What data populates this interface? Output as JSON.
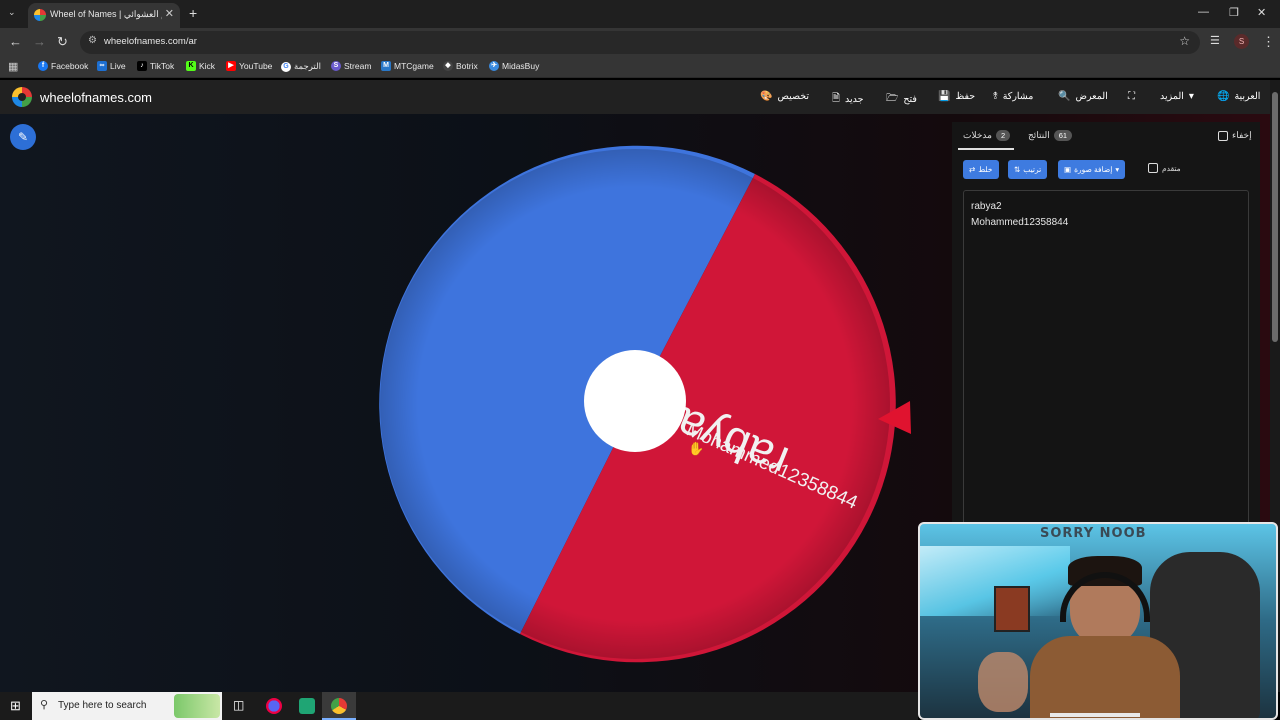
{
  "browser": {
    "tab_title": "Wheel of Names | عجلة الاسم العشوائي",
    "url": "wheelofnames.com/ar",
    "bookmarks": [
      "Facebook",
      "Live",
      "TikTok",
      "Kick",
      "YouTube",
      "الترجمة",
      "Stream",
      "MTCgame",
      "Botrix",
      "MidasBuy"
    ],
    "profile_initial": "S"
  },
  "site": {
    "name": "wheelofnames.com",
    "menu": [
      "تخصيص",
      "جديد",
      "فتح",
      "حفظ",
      "مشاركة",
      "المعرض",
      "المزيد",
      "العربية"
    ]
  },
  "wheel": {
    "segments": [
      {
        "label": "rabya2",
        "color": "#3e74dd"
      },
      {
        "label": "Mohammed12358844",
        "color": "#d01638"
      }
    ],
    "center_color": "#ffffff",
    "pointer_color": "#e0132f"
  },
  "panel": {
    "tab_entries": "مدخلات",
    "tab_entries_count": "2",
    "tab_results": "النتائج",
    "tab_results_count": "61",
    "hide_label": "إخفاء",
    "shuffle_label": "خلط",
    "sort_label": "ترتيب",
    "add_image_label": "إضافة صورة",
    "advanced_label": "متقدم",
    "entries": [
      "rabya2",
      "Mohammed12358844"
    ]
  },
  "webcam": {
    "banner_text": "SORRY NOOB"
  },
  "taskbar": {
    "search_placeholder": "Type here to search"
  }
}
